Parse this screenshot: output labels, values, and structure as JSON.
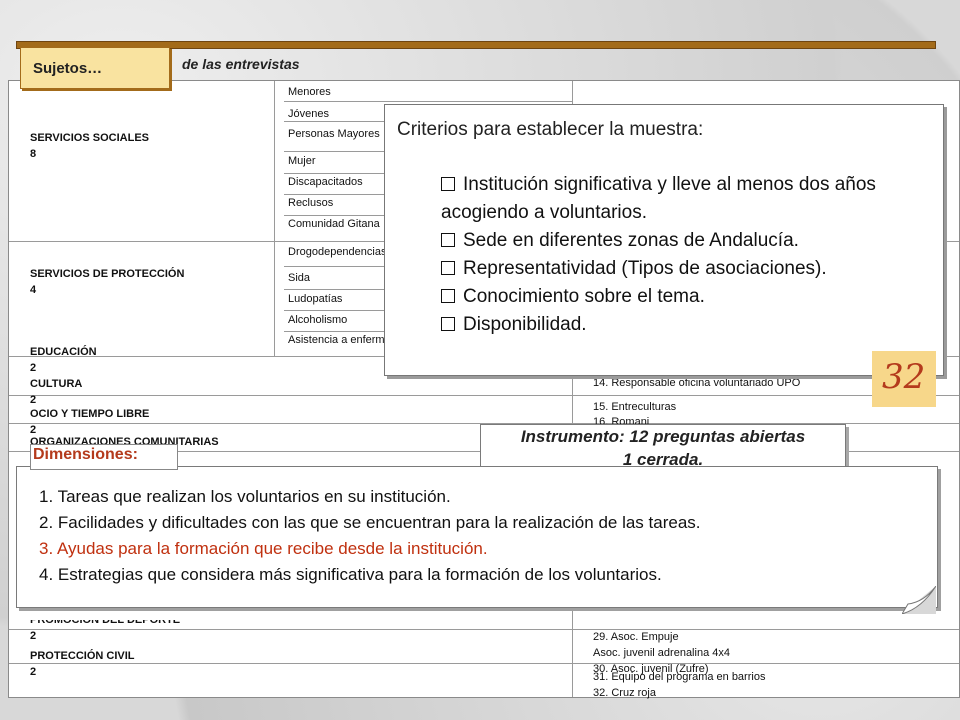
{
  "header": {
    "tab_label": "Sujetos…",
    "subtitle": "de las entrevistas"
  },
  "table": {
    "left": [
      {
        "key": "ss",
        "title": "SERVICIOS SOCIALES",
        "count": "8"
      },
      {
        "key": "sp",
        "title": "SERVICIOS DE PROTECCIÓN",
        "count": "4"
      },
      {
        "key": "ed",
        "title": "EDUCACIÓN",
        "count": "2"
      },
      {
        "key": "cu",
        "title": "CULTURA",
        "count": "2"
      },
      {
        "key": "oc",
        "title": "OCIO Y TIEMPO LIBRE",
        "count": "2"
      },
      {
        "key": "oco",
        "title": "ORGANIZACIONES COMUNITARIAS",
        "count": ""
      },
      {
        "key": "pd",
        "title": "PROMOCIÓN DEL DEPORTE",
        "count": "2"
      },
      {
        "key": "pc",
        "title": "PROTECCIÓN CIVIL",
        "count": "2"
      }
    ],
    "middle": [
      "Menores",
      "Jóvenes",
      "Personas Mayores",
      "Mujer",
      "Discapacitados",
      "Reclusos",
      "Comunidad Gitana",
      "Drogodependencias",
      "Sida",
      "Ludopatías",
      "Alcoholismo",
      "Asistencia a enfermos"
    ],
    "right": [
      "14. Responsable oficina voluntariado UPO",
      "15. Entreculturas",
      "16. Romani",
      "29. Asoc. Empuje",
      "Asoc. juvenil adrenalina 4x4",
      "30. Asoc. juvenil (Zufre)",
      "31. Equipo del programa en barrios",
      "32. Cruz roja"
    ]
  },
  "criteria": {
    "title": "Criterios para establecer la muestra:",
    "items": [
      "Institución significativa y lleve al menos dos años acogiendo a voluntarios.",
      "Sede en diferentes zonas de Andalucía.",
      "Representatividad (Tipos de asociaciones).",
      "Conocimiento sobre el tema.",
      "Disponibilidad."
    ]
  },
  "badge": "32",
  "instrument": {
    "line1": "Instrumento: 12 preguntas abiertas",
    "line2": "1 cerrada."
  },
  "dimensions": {
    "label": "Dimensiones:",
    "items": [
      "1. Tareas que realizan los voluntarios en su institución.",
      "2. Facilidades y dificultades con las que se encuentran para la realización de las tareas.",
      "3. Ayudas para la formación que recibe desde la institución.",
      "4. Estrategias que considera más significativa para la formación de los voluntarios."
    ]
  },
  "colors": {
    "accent": "#a36b1a",
    "tab_fill": "#f9e3a0",
    "highlight_text": "#c0300f",
    "badge_fill": "#f7d78a"
  }
}
